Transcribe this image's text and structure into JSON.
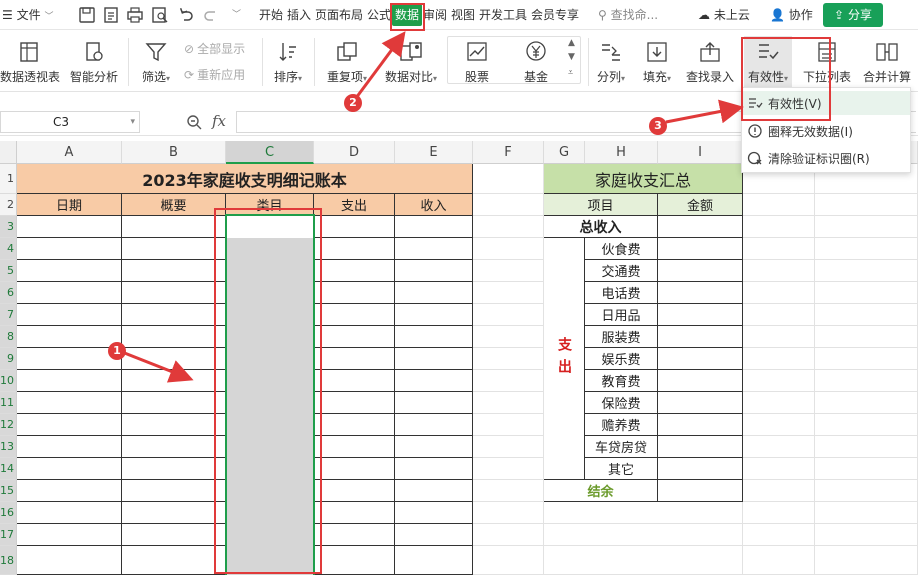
{
  "menubar": {
    "file": "文件",
    "tabs": [
      "开始",
      "插入",
      "页面布局",
      "公式",
      "数据",
      "审阅",
      "视图",
      "开发工具",
      "会员专享"
    ],
    "active_tab": "数据",
    "search": "查找命...",
    "cloud": "未上云",
    "collab": "协作",
    "share": "分享"
  },
  "ribbon": {
    "pivot": "数据透视表",
    "smart": "智能分析",
    "filter": "筛选",
    "show_all": "全部显示",
    "reapply": "重新应用",
    "sort": "排序",
    "duplicate": "重复项",
    "compare": "数据对比",
    "stock": "股票",
    "fund": "基金",
    "split": "分列",
    "fill": "填充",
    "lookup": "查找录入",
    "validity": "有效性",
    "dropdown_list": "下拉列表",
    "merge_calc": "合并计算"
  },
  "formula_bar": {
    "cell_ref": "C3",
    "fx": "fx",
    "value": ""
  },
  "validity_menu": {
    "items": [
      "有效性(V)",
      "圈释无效数据(I)",
      "清除验证标识圈(R)"
    ]
  },
  "columns": [
    "A",
    "B",
    "C",
    "D",
    "E",
    "F",
    "G",
    "H",
    "I"
  ],
  "rows": [
    "1",
    "2",
    "3",
    "4",
    "5",
    "6",
    "7",
    "8",
    "9",
    "10",
    "11",
    "12",
    "13",
    "14",
    "15",
    "16",
    "17",
    "18"
  ],
  "ledger": {
    "title": "2023年家庭收支明细记账本",
    "headers": [
      "日期",
      "概要",
      "类目",
      "支出",
      "收入"
    ]
  },
  "summary": {
    "title": "家庭收支汇总",
    "col_item": "项目",
    "col_amount": "金额",
    "total_income": "总收入",
    "expense_label": "支出",
    "expense_items": [
      "伙食费",
      "交通费",
      "电话费",
      "日用品",
      "服装费",
      "娱乐费",
      "教育费",
      "保险费",
      "赡养费",
      "车贷房贷",
      "其它"
    ],
    "balance": "结余"
  },
  "annotations": [
    "1",
    "2",
    "3"
  ],
  "colors": {
    "accent": "#1f9e4b",
    "header_fill": "#f8cba6",
    "summary_title_fill": "#c6e0a8",
    "summary_header_fill": "#e5f0d9",
    "selection_fill": "#d6d6d6",
    "annotation": "#e03a3a",
    "expense_text": "#d62020",
    "balance_text": "#6a9a2a"
  }
}
